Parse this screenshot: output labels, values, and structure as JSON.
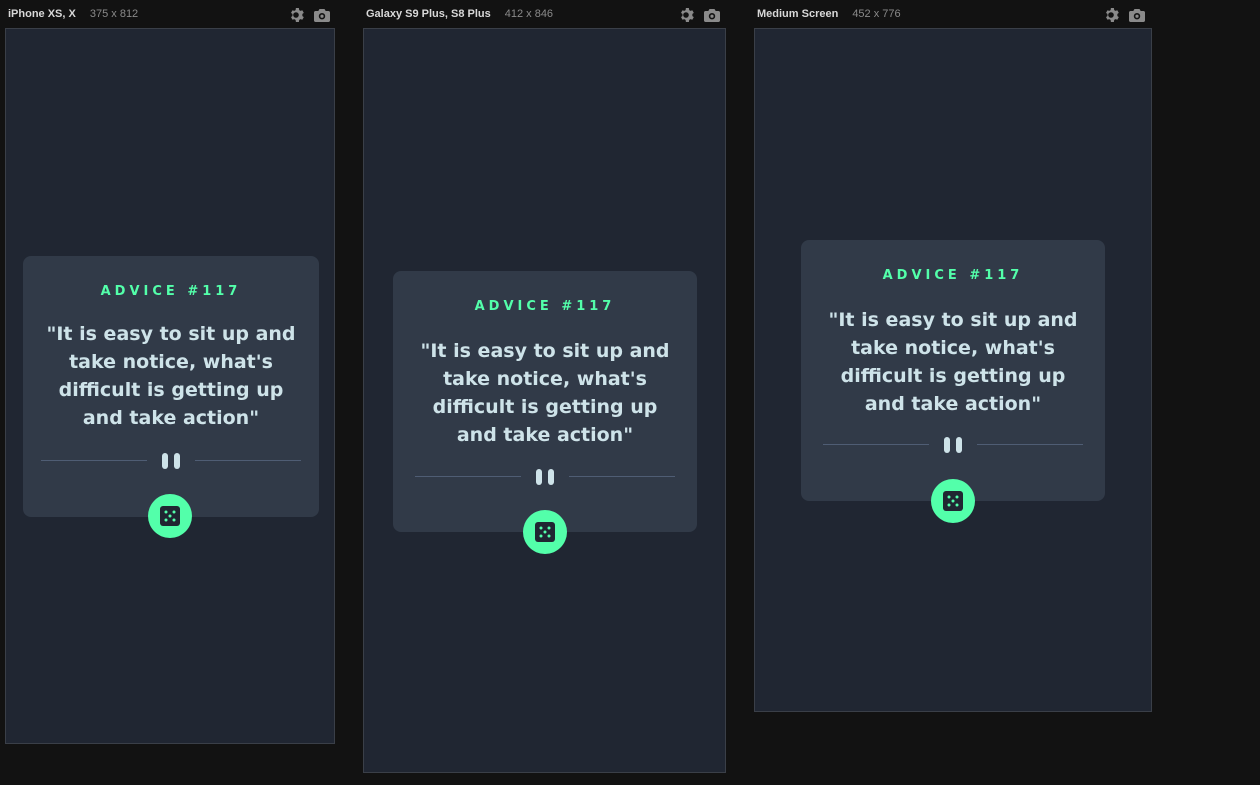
{
  "colors": {
    "page_bg": "#121212",
    "viewport_bg": "#202632",
    "card_bg": "#313a48",
    "accent": "#53ffaa",
    "quote_text": "#cee3e9",
    "divider": "#4f5d74"
  },
  "frames": [
    {
      "device_name": "iPhone XS, X",
      "size_label": "375 x 812",
      "icons": [
        "gear-icon",
        "camera-icon"
      ],
      "card": {
        "advice_label": "ADVICE #117",
        "quote": "\"It is easy to sit up and take notice, what's difficult is getting up and take action\"",
        "button_icon": "dice-icon"
      }
    },
    {
      "device_name": "Galaxy S9 Plus, S8 Plus",
      "size_label": "412 x 846",
      "icons": [
        "gear-icon",
        "camera-icon"
      ],
      "card": {
        "advice_label": "ADVICE #117",
        "quote": "\"It is easy to sit up and take notice, what's difficult is getting up and take action\"",
        "button_icon": "dice-icon"
      }
    },
    {
      "device_name": "Medium Screen",
      "size_label": "452 x 776",
      "icons": [
        "gear-icon",
        "camera-icon"
      ],
      "card": {
        "advice_label": "ADVICE #117",
        "quote": "\"It is easy to sit up and take notice, what's difficult is getting up and take action\"",
        "button_icon": "dice-icon"
      }
    }
  ]
}
